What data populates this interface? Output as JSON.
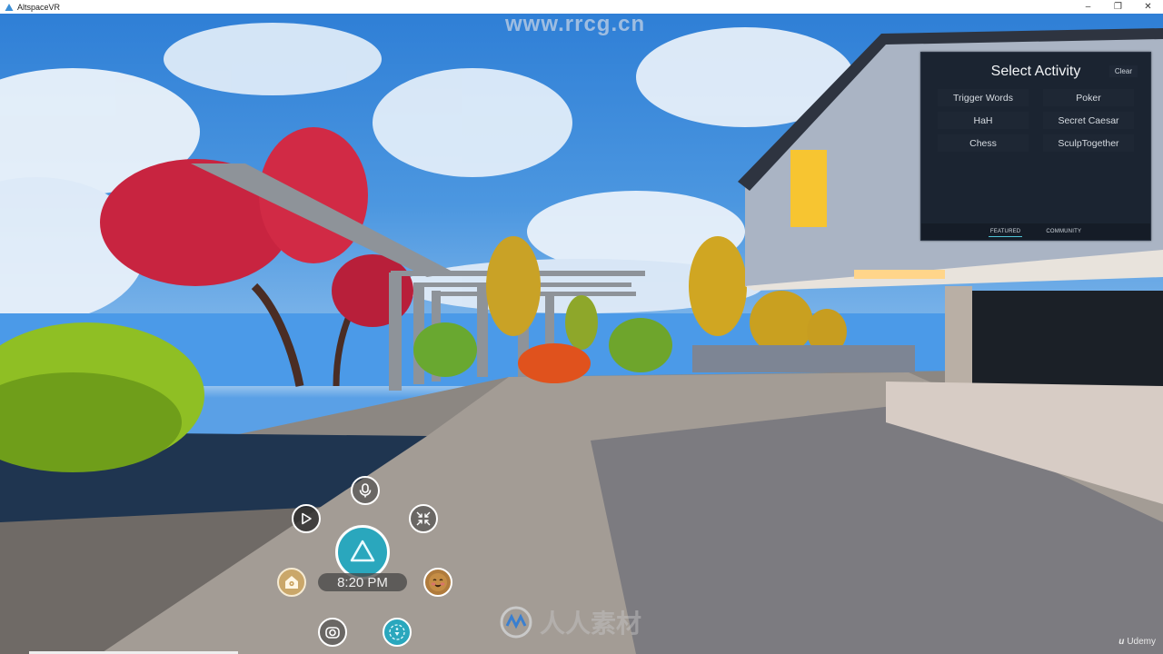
{
  "window": {
    "title": "AltspaceVR",
    "controls": {
      "minimize": "–",
      "restore": "❐",
      "close": "✕"
    }
  },
  "activity_panel": {
    "title": "Select Activity",
    "clear_label": "Clear",
    "activities": [
      "Trigger Words",
      "Poker",
      "HaH",
      "Secret Caesar",
      "Chess",
      "SculpTogether"
    ],
    "tabs": [
      {
        "label": "FEATURED",
        "active": true
      },
      {
        "label": "COMMUNITY",
        "active": false
      }
    ],
    "accent_color": "#4fc3d6"
  },
  "radial_menu": {
    "clock": "8:20 PM",
    "buttons": [
      {
        "name": "microphone",
        "icon": "microphone-icon"
      },
      {
        "name": "play",
        "icon": "play-icon"
      },
      {
        "name": "collapse",
        "icon": "collapse-arrows-icon"
      },
      {
        "name": "main-menu",
        "icon": "altspace-logo-icon"
      },
      {
        "name": "home-settings",
        "icon": "home-gear-icon"
      },
      {
        "name": "emoji",
        "icon": "smiling-face-icon"
      },
      {
        "name": "camera",
        "icon": "camera-icon"
      },
      {
        "name": "teleport",
        "icon": "teleport-icon"
      }
    ],
    "accent_color": "#2aa7bd"
  },
  "watermarks": {
    "url": "www.rrcg.cn",
    "brand": "人人素材",
    "udemy": "Udemy"
  }
}
